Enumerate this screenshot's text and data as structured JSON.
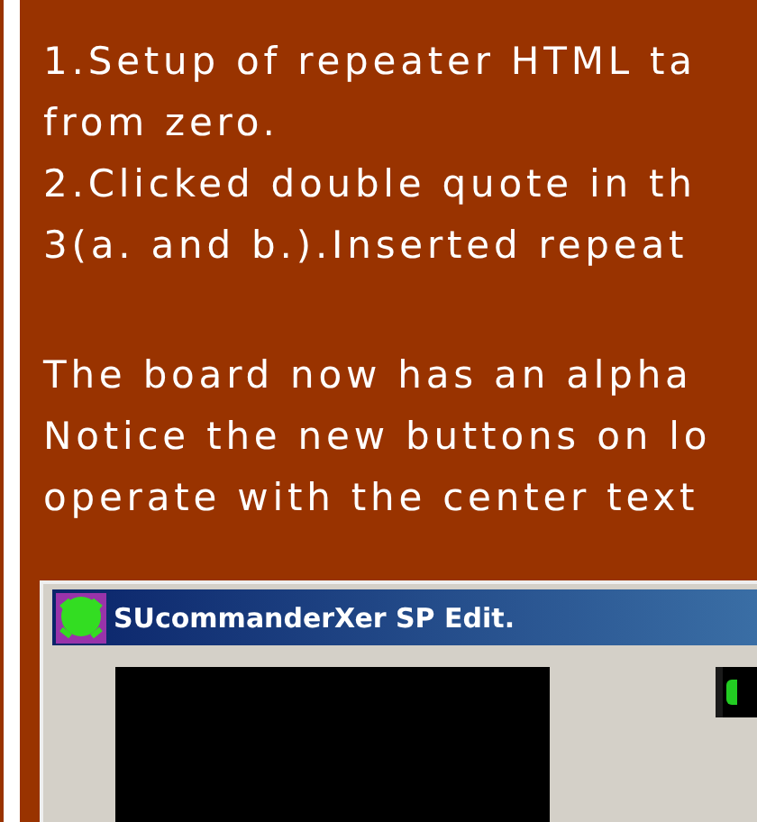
{
  "paragraphs": [
    {
      "lines": [
        "1.Setup of repeater HTML ta",
        "from zero.",
        "2.Clicked double quote in th",
        "3(a. and b.).Inserted repeat"
      ]
    },
    {
      "lines": [
        "The board now has an alpha",
        "Notice the new buttons on lo",
        "operate with the center text"
      ]
    }
  ],
  "screenshot": {
    "window_title": "SUcommanderXer SP Edit."
  }
}
